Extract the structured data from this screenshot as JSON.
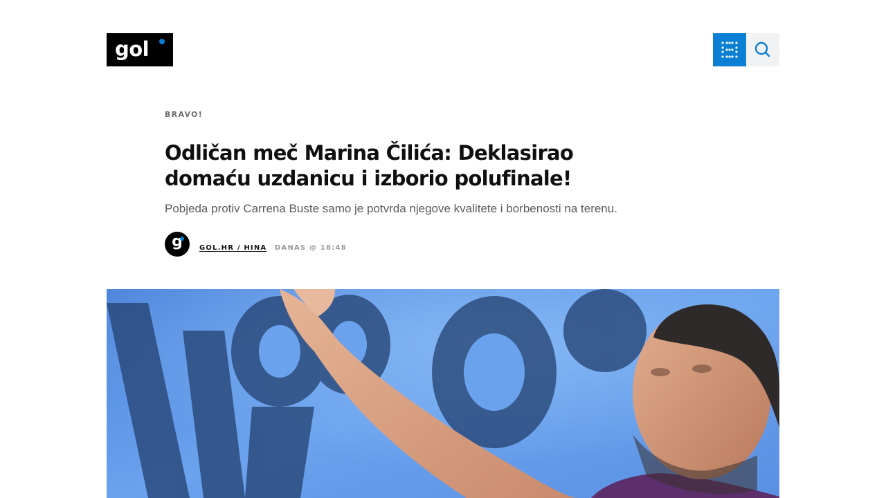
{
  "header": {
    "logo_text": "gol",
    "menu_icon": "grid-dots-icon",
    "search_icon": "search-icon",
    "accent_color": "#0b7fd3"
  },
  "article": {
    "kicker": "BRAVO!",
    "title": "Odličan meč Marina Čilića: Deklasirao domaću uzdanicu i izborio polufinale!",
    "lead": "Pobjeda protiv Carrena Buste samo je potvrda njegove kvalitete i borbenosti na terenu.",
    "byline": {
      "avatar_letter": "g",
      "author": "GOL.HR / HINA",
      "time": "DANAS @ 18:48"
    }
  }
}
